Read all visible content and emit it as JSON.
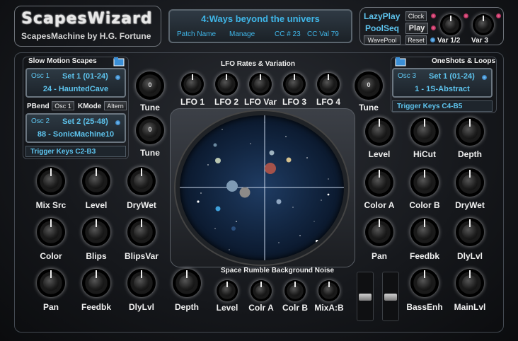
{
  "header": {
    "logo": "ScapesWizard",
    "subtitle": "ScapesMachine by H.G. Fortune",
    "patch_display": "4:Ways beyond the univers",
    "patch_name_label": "Patch Name",
    "manage_label": "Manage",
    "cc_number": "CC # 23",
    "cc_value": "CC Val 79"
  },
  "top_controls": {
    "lazyplay": "LazyPlay",
    "clock": "Clock",
    "poolseq": "PoolSeq",
    "play": "Play",
    "wavepool": "WavePool",
    "reset": "Reset",
    "var12": "Var 1/2",
    "var3": "Var 3"
  },
  "left_section": {
    "title": "Slow Motion Scapes",
    "osc1": {
      "label": "Osc 1",
      "set": "Set 1 (01-24)",
      "patch": "24 - HauntedCave"
    },
    "pbend": "PBend",
    "osc1_btn": "Osc 1",
    "kmode": "KMode",
    "altern": "Altern",
    "osc2": {
      "label": "Osc 2",
      "set": "Set 2 (25-48)",
      "patch": "88 - SonicMachine10"
    },
    "trigger": "Trigger Keys C2-B3",
    "tune1": "Tune",
    "tune2": "Tune",
    "tune_value": "0"
  },
  "lfo": {
    "title": "LFO Rates & Variation",
    "knobs": [
      "LFO 1",
      "LFO 2",
      "LFO Var",
      "LFO 3",
      "LFO 4"
    ],
    "tune": "Tune",
    "tune_value": "0"
  },
  "right_section": {
    "title": "OneShots & Loops",
    "osc3": {
      "label": "Osc 3",
      "set": "Set 1 (01-24)",
      "patch": "1 - 1S-Abstract"
    },
    "trigger": "Trigger Keys C4-B5"
  },
  "left_knobs": {
    "row1": [
      "Mix Src",
      "Level",
      "DryWet"
    ],
    "row2": [
      "Color",
      "Blips",
      "BlipsVar"
    ],
    "row3": [
      "Pan",
      "Feedbk",
      "DlyLvl",
      "Depth"
    ]
  },
  "right_knobs": {
    "row1": [
      "Level",
      "HiCut",
      "Depth"
    ],
    "row2": [
      "Color A",
      "Color B",
      "DryWet"
    ],
    "row3": [
      "Pan",
      "Feedbk",
      "DlyLvl"
    ],
    "row4": [
      "BassEnh",
      "MainLvl"
    ]
  },
  "noise": {
    "title": "Space Rumble Background Noise",
    "knobs": [
      "Level",
      "Colr A",
      "Colr B",
      "MixA:B"
    ]
  }
}
